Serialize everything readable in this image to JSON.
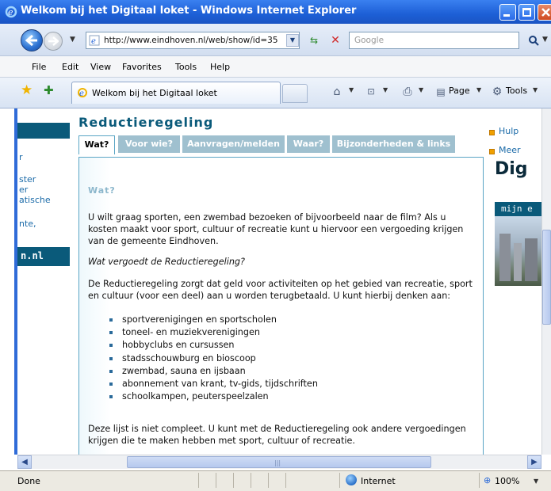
{
  "window": {
    "title": "Welkom bij het Digitaal loket - Windows Internet Explorer"
  },
  "address_bar": {
    "url": "http://www.eindhoven.nl/web/show/id=35",
    "search_placeholder": "Google"
  },
  "menu": [
    "File",
    "Edit",
    "View",
    "Favorites",
    "Tools",
    "Help"
  ],
  "tabs": {
    "active_label": "Welkom bij het Digitaal loket"
  },
  "toolbar": {
    "page_label": "Page",
    "tools_label": "Tools"
  },
  "left_nav": {
    "fragments": [
      "r",
      "ster",
      "er",
      "atische",
      "nte,"
    ],
    "bar_text": "n.nl"
  },
  "content": {
    "heading": "Reductieregeling",
    "tabs": [
      "Wat?",
      "Voor wie?",
      "Aanvragen/melden",
      "Waar?",
      "Bijzonderheden & links"
    ],
    "active_tab": "Wat?",
    "section_title": "Wat?",
    "intro": "U wilt graag sporten, een zwembad bezoeken of bijvoorbeeld naar de film? Als u kosten maakt voor sport, cultuur of recreatie kunt u hiervoor een vergoeding krijgen van de gemeente Eindhoven.",
    "subquestion": "Wat vergoedt de Reductieregeling?",
    "para2": "De Reductieregeling zorgt dat geld voor activiteiten op het gebied van recreatie, sport en cultuur (voor een deel) aan u worden terugbetaald. U kunt hierbij denken aan:",
    "bullets": [
      "sportverenigingen en sportscholen",
      "toneel- en muziekverenigingen",
      "hobbyclubs en cursussen",
      "stadsschouwburg en bioscoop",
      "zwembad, sauna en ijsbaan",
      "abonnement van krant, tv-gids, tijdschriften",
      "schoolkampen, peuterspeelzalen"
    ],
    "para3": "Deze lijst is niet compleet. U kunt met de Reductieregeling ook andere vergoedingen krijgen die te maken hebben met sport, cultuur of recreatie."
  },
  "right_col": {
    "links": [
      "Hulp",
      "Meer"
    ],
    "logo_text": "Dig",
    "bar_text": "mijn e"
  },
  "status": {
    "text": "Done",
    "zone": "Internet",
    "zoom": "100%"
  }
}
